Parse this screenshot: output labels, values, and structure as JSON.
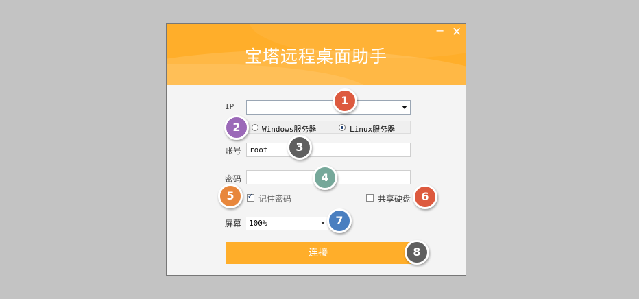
{
  "window": {
    "title": "宝塔远程桌面助手",
    "minimize_glyph": "−",
    "close_glyph": "✕"
  },
  "form": {
    "ip_label": "IP",
    "ip_value": "",
    "server_types": [
      {
        "label": "Windows服务器",
        "checked": false
      },
      {
        "label": "Linux服务器",
        "checked": true
      }
    ],
    "account_label": "账号",
    "account_value": "root",
    "password_label": "密码",
    "password_value": "",
    "remember_label": "记住密码",
    "remember_checked": true,
    "share_disk_label": "共享硬盘",
    "share_disk_checked": false,
    "screen_label": "屏幕",
    "screen_value": "100%",
    "connect_label": "连接"
  },
  "callouts": [
    {
      "num": "1",
      "color": "#dd5a3f"
    },
    {
      "num": "2",
      "color": "#9b69b8"
    },
    {
      "num": "3",
      "color": "#5f5f5f"
    },
    {
      "num": "4",
      "color": "#76a89a"
    },
    {
      "num": "5",
      "color": "#e8873c"
    },
    {
      "num": "6",
      "color": "#dd5a3f"
    },
    {
      "num": "7",
      "color": "#4a7fc0"
    },
    {
      "num": "8",
      "color": "#5f5f5f"
    }
  ]
}
